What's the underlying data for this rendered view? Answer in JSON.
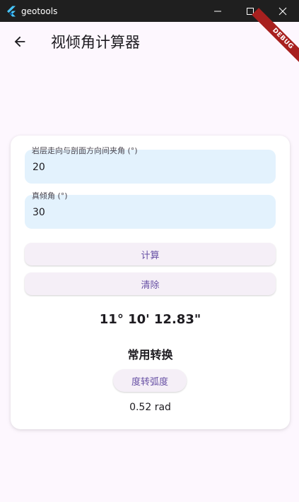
{
  "window": {
    "title": "geotools",
    "controls": [
      "minimize-icon",
      "maximize-icon",
      "close-icon"
    ]
  },
  "appbar": {
    "back_icon": "arrow-back-icon",
    "title": "视倾角计算器"
  },
  "debug_banner": "DEBUG",
  "form": {
    "angle_field": {
      "label": "岩层走向与剖面方向间夹角 (°)",
      "value": "20"
    },
    "dip_field": {
      "label": "真倾角 (°)",
      "value": "30"
    },
    "calculate_label": "计算",
    "clear_label": "清除"
  },
  "result": {
    "apparent_dip": "11° 10' 12.83\""
  },
  "conversion": {
    "title": "常用转换",
    "button_label": "度转弧度",
    "output": "0.52 rad"
  },
  "colors": {
    "background": "#fdf7fe",
    "titlebar": "#1f1f1f",
    "field_fill": "#e3f2fd",
    "button_fill": "#f5eff7",
    "accent": "#6750a4",
    "ribbon": "#a8201f"
  }
}
